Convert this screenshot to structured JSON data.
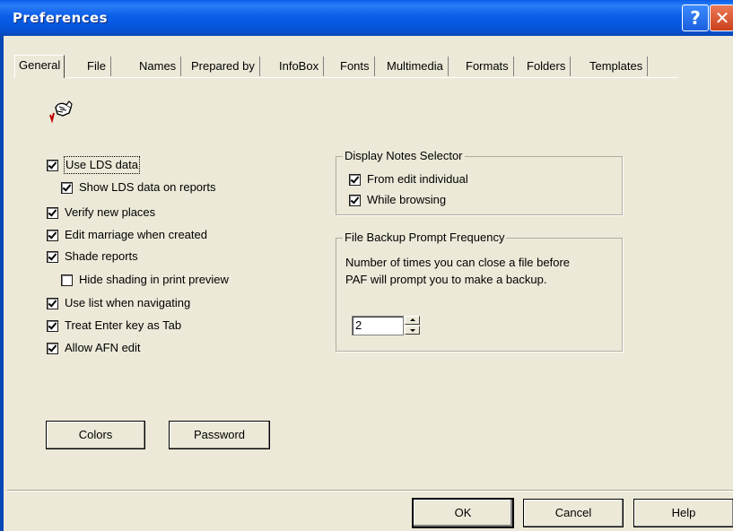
{
  "window": {
    "title": "Preferences",
    "help_glyph": "?",
    "close_glyph": "✕"
  },
  "tabs": [
    {
      "label": "General",
      "active": true
    },
    {
      "label": "File"
    },
    {
      "label": "Names"
    },
    {
      "label": "Prepared by"
    },
    {
      "label": "InfoBox"
    },
    {
      "label": "Fonts"
    },
    {
      "label": "Multimedia"
    },
    {
      "label": "Formats"
    },
    {
      "label": "Folders"
    },
    {
      "label": "Templates"
    }
  ],
  "icon": {
    "name": "paf-hand-icon"
  },
  "general": {
    "use_lds_data": {
      "label": "Use LDS data",
      "checked": true
    },
    "show_lds_on_reports": {
      "label": "Show LDS data on reports",
      "checked": true
    },
    "verify_new_places": {
      "label": "Verify new places",
      "checked": true
    },
    "edit_marriage": {
      "label": "Edit marriage when created",
      "checked": true
    },
    "shade_reports": {
      "label": "Shade reports",
      "checked": true
    },
    "hide_shading": {
      "label": "Hide shading in print preview",
      "checked": false
    },
    "use_list_navigating": {
      "label": "Use list when navigating",
      "checked": true
    },
    "treat_enter_as_tab": {
      "label": "Treat Enter key as Tab",
      "checked": true
    },
    "allow_afn_edit": {
      "label": "Allow AFN edit",
      "checked": true
    }
  },
  "display_notes": {
    "legend": "Display Notes Selector",
    "from_edit_individual": {
      "label": "From edit individual",
      "checked": true
    },
    "while_browsing": {
      "label": "While browsing",
      "checked": true
    }
  },
  "backup": {
    "legend": "File Backup Prompt Frequency",
    "description_line1": "Number of times you can close a file before",
    "description_line2": "PAF will prompt you to make a backup.",
    "value": "2"
  },
  "buttons": {
    "colors": "Colors",
    "password": "Password",
    "ok": "OK",
    "cancel": "Cancel",
    "help": "Help"
  }
}
